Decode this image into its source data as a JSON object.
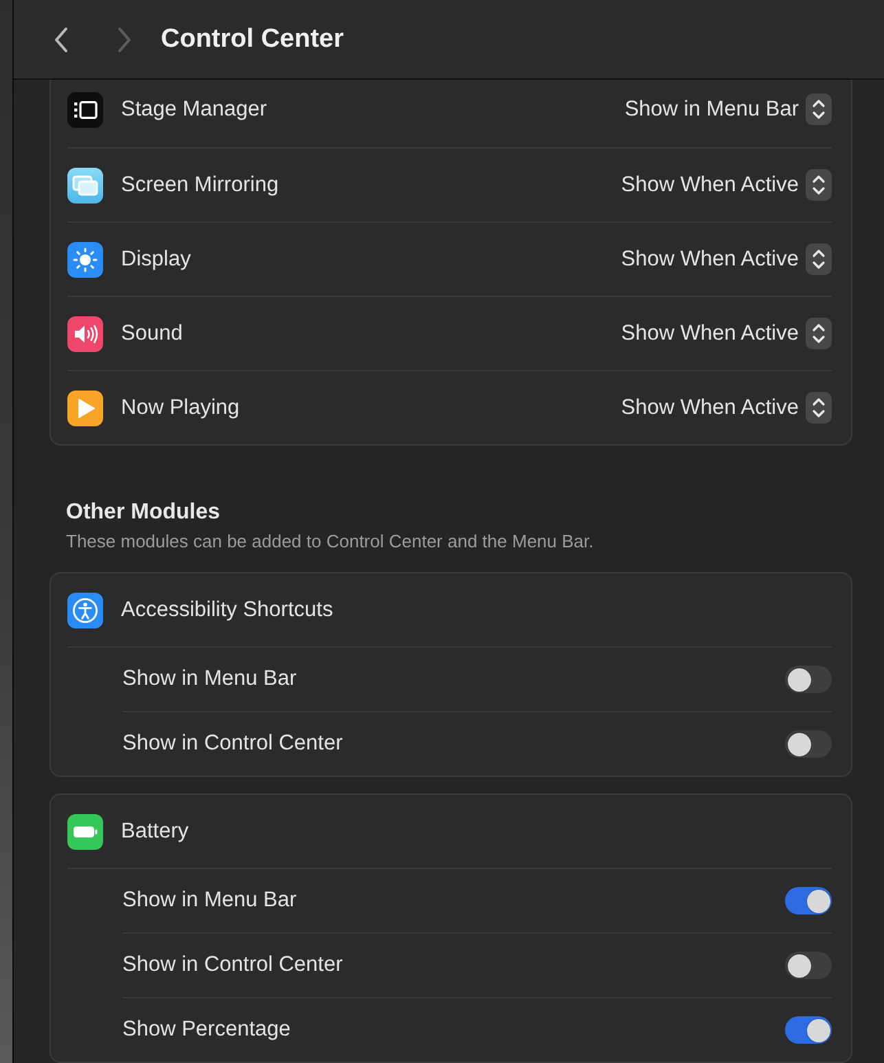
{
  "window": {
    "title": "Control Center"
  },
  "nav_buttons": [
    {
      "kind": "back",
      "disabled": false
    },
    {
      "kind": "forward",
      "disabled": true
    }
  ],
  "modules": [
    {
      "kind": "stage_manager",
      "label": "Stage Manager",
      "value": "Show in Menu Bar"
    },
    {
      "kind": "screen_mirroring",
      "label": "Screen Mirroring",
      "value": "Show When Active"
    },
    {
      "kind": "display",
      "label": "Display",
      "value": "Show When Active"
    },
    {
      "kind": "sound",
      "label": "Sound",
      "value": "Show When Active"
    },
    {
      "kind": "now_playing",
      "label": "Now Playing",
      "value": "Show When Active"
    }
  ],
  "other_modules": {
    "title": "Other Modules",
    "subtitle": "These modules can be added to Control Center and the Menu Bar.",
    "groups": [
      {
        "kind": "accessibility",
        "label": "Accessibility Shortcuts",
        "options": [
          {
            "label": "Show in Menu Bar",
            "on": false
          },
          {
            "label": "Show in Control Center",
            "on": false
          }
        ]
      },
      {
        "kind": "battery",
        "label": "Battery",
        "options": [
          {
            "label": "Show in Menu Bar",
            "on": true
          },
          {
            "label": "Show in Control Center",
            "on": false
          },
          {
            "label": "Show Percentage",
            "on": true
          }
        ]
      }
    ]
  }
}
